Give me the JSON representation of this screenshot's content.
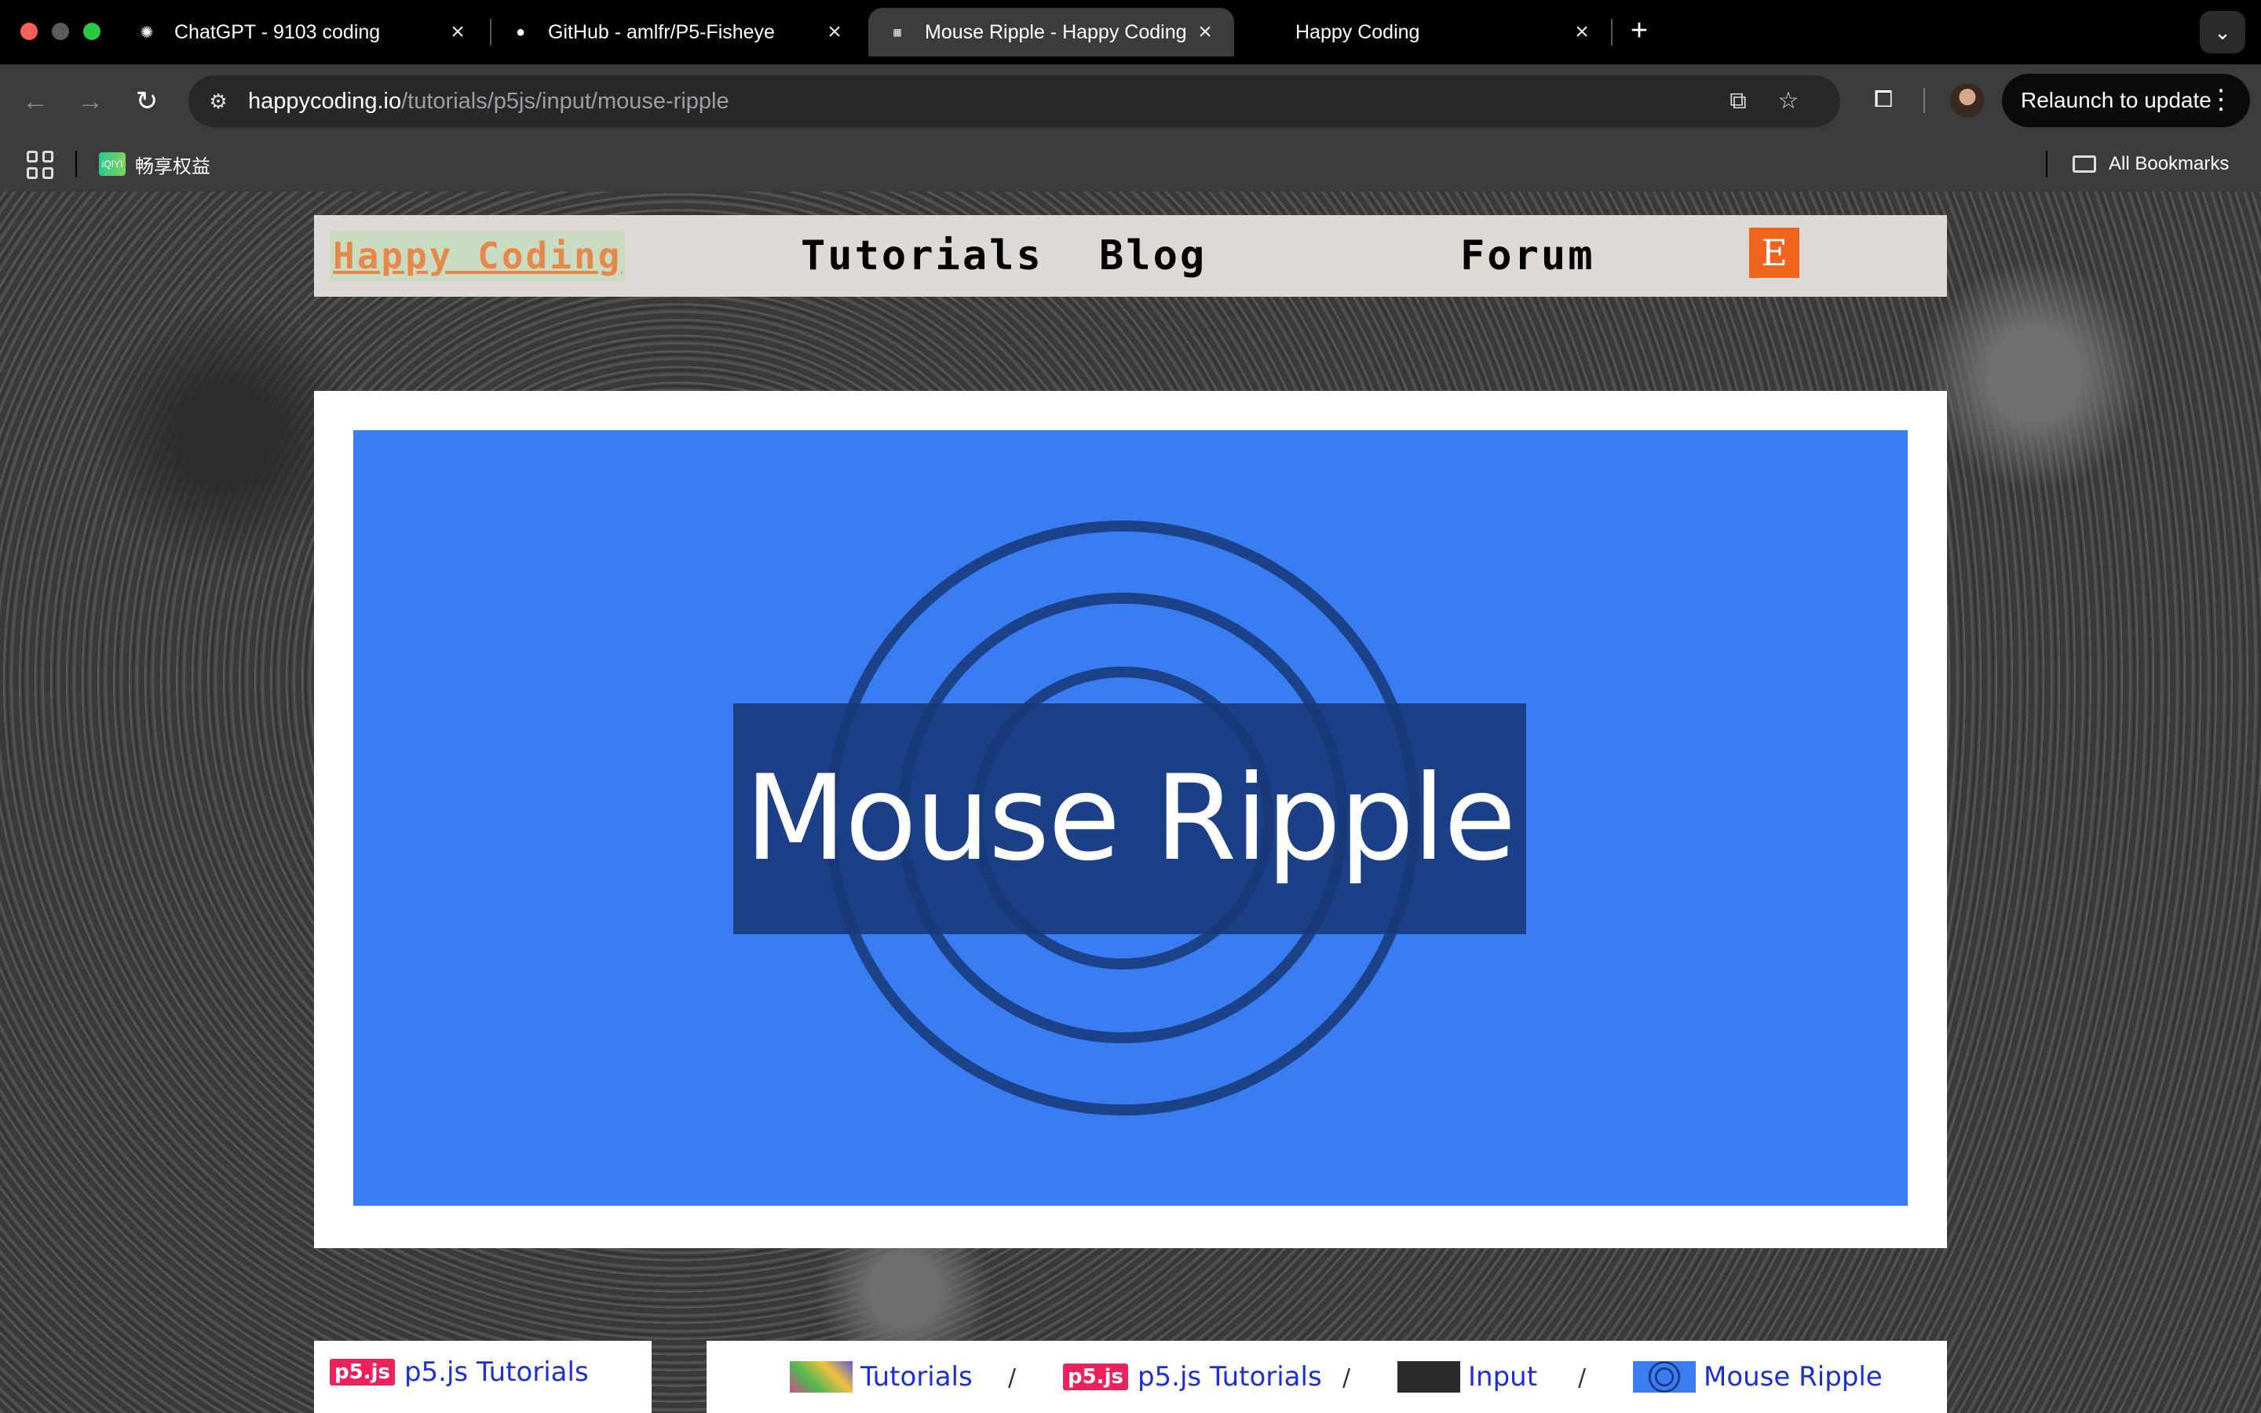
{
  "browser": {
    "tabs": [
      {
        "title": "ChatGPT - 9103 coding",
        "icon": "openai-icon",
        "active": false
      },
      {
        "title": "GitHub - amlfr/P5-Fisheye",
        "icon": "github-icon",
        "active": false
      },
      {
        "title": "Mouse Ripple - Happy Coding",
        "icon": "happy-coding-favicon",
        "active": true
      },
      {
        "title": "Happy Coding",
        "icon": "blank-favicon",
        "active": false
      }
    ],
    "url_host": "happycoding.io",
    "url_path": "/tutorials/p5js/input/mouse-ripple",
    "relaunch_label": "Relaunch to update",
    "bookmarks": [
      {
        "label": "畅享权益"
      }
    ],
    "all_bookmarks_label": "All Bookmarks"
  },
  "site": {
    "logo": "Happy Coding",
    "nav": [
      "Tutorials",
      "Blog",
      "Forum"
    ],
    "etsy_letter": "E"
  },
  "hero": {
    "title": "Mouse Ripple",
    "bg_color": "#3a7cf2",
    "ring_color": "#183878"
  },
  "sidebar": {
    "badge": "p5.js",
    "link": "p5.js Tutorials"
  },
  "breadcrumb": [
    {
      "label": "Tutorials"
    },
    {
      "label": "p5.js Tutorials",
      "badge": "p5.js"
    },
    {
      "label": "Input"
    },
    {
      "label": "Mouse Ripple"
    }
  ],
  "breadcrumb_separator": "/"
}
